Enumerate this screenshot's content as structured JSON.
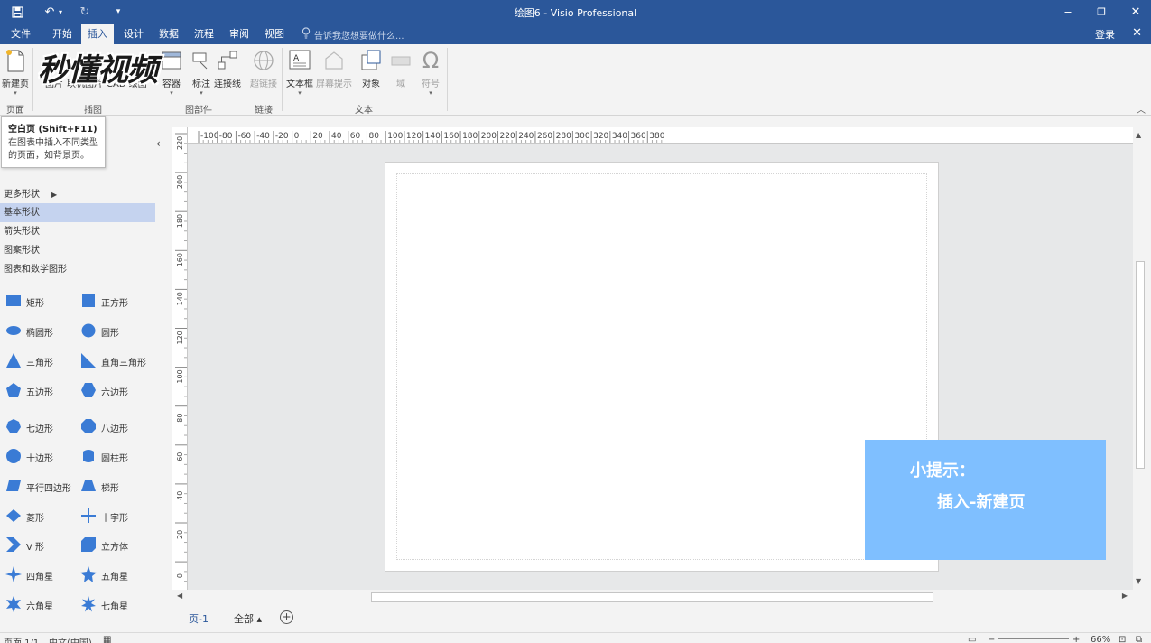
{
  "titlebar": {
    "title": "绘图6 - Visio Professional",
    "minimize": "‒",
    "restore": "❐",
    "close": "✕"
  },
  "menu": {
    "tabs": [
      "文件",
      "开始",
      "插入",
      "设计",
      "数据",
      "流程",
      "审阅",
      "视图"
    ],
    "active_tab": "插入",
    "tell_me": "告诉我您想要做什么...",
    "login": "登录",
    "close_doc": "✕"
  },
  "watermark": "秒懂视频",
  "ribbon": {
    "buttons": {
      "new_page": "新建页",
      "picture": "图片",
      "online_picture": "联机图片",
      "cad": "CAD 绘图",
      "container": "容器",
      "callout": "标注",
      "connector": "连接线",
      "hyperlink": "超链接",
      "textbox": "文本框",
      "screentip": "屏幕提示",
      "object": "对象",
      "field": "域",
      "symbol": "符号"
    },
    "groups": {
      "pages": "页面",
      "illustrations": "插图",
      "diagram_parts": "图部件",
      "links": "链接",
      "text": "文本"
    }
  },
  "tooltip": {
    "title": "空白页 (Shift+F11)",
    "body": "在图表中插入不同类型的页面，如背景页。"
  },
  "shapes_panel": {
    "categories": [
      "更多形状",
      "基本形状",
      "箭头形状",
      "图案形状",
      "图表和数学图形"
    ],
    "selected": "基本形状",
    "shapes": [
      [
        "矩形",
        "正方形"
      ],
      [
        "椭圆形",
        "圆形"
      ],
      [
        "三角形",
        "直角三角形"
      ],
      [
        "五边形",
        "六边形"
      ],
      [
        "七边形",
        "八边形"
      ],
      [
        "十边形",
        "圆柱形"
      ],
      [
        "平行四边形",
        "梯形"
      ],
      [
        "菱形",
        "十字形"
      ],
      [
        "V 形",
        "立方体"
      ],
      [
        "四角星",
        "五角星"
      ],
      [
        "六角星",
        "七角星"
      ]
    ],
    "shape_color": "#3a7bd5"
  },
  "rulers": {
    "horizontal": [
      "-100",
      "-80",
      "-60",
      "-40",
      "-20",
      "0",
      "20",
      "40",
      "60",
      "80",
      "100",
      "120",
      "140",
      "160",
      "180",
      "200",
      "220",
      "240",
      "260",
      "280",
      "300",
      "320",
      "340",
      "360",
      "380"
    ],
    "vertical": [
      "220",
      "200",
      "180",
      "160",
      "140",
      "120",
      "100",
      "80",
      "60",
      "40",
      "20",
      "0"
    ]
  },
  "page_tabs": {
    "current": "页-1",
    "all": "全部 ▴",
    "add": "+"
  },
  "statusbar": {
    "page": "页面 1/1",
    "language": "中文(中国)",
    "zoom": "66%"
  },
  "tip": {
    "line1": "小提示：",
    "line2": "插入-新建页"
  },
  "colors": {
    "accent": "#2b579a",
    "tip_bg": "#7fbfff",
    "selected_bg": "#c5d3ef"
  }
}
